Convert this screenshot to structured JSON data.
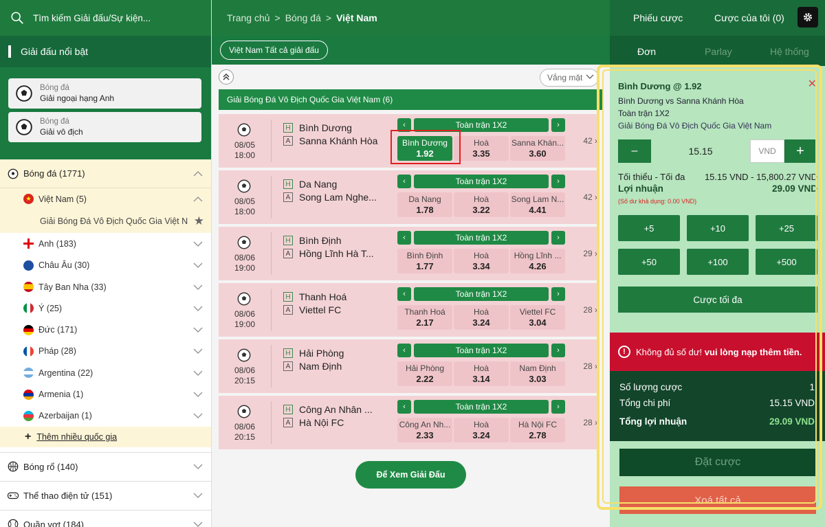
{
  "left": {
    "search_placeholder": "Tìm kiếm Giải đấu/Sự kiện...",
    "featured_title": "Giải đấu nổi bật",
    "featured": [
      {
        "sport": "Bóng đá",
        "name": "Giải ngoại hạng Anh"
      },
      {
        "sport": "Bóng đá",
        "name": "Giải vô địch"
      }
    ],
    "football": "Bóng đá (1771)",
    "countries": [
      {
        "name": "Việt Nam (5)"
      },
      {
        "name": "Anh (183)"
      },
      {
        "name": "Châu Âu (30)"
      },
      {
        "name": "Tây Ban Nha (33)"
      },
      {
        "name": "Ý (25)"
      },
      {
        "name": "Đức (171)"
      },
      {
        "name": "Pháp (28)"
      },
      {
        "name": "Argentina (22)"
      },
      {
        "name": "Armenia (1)"
      },
      {
        "name": "Azerbaijan (1)"
      }
    ],
    "league_item": "Giải Bóng Đá Vô Địch Quốc Gia Việt N",
    "more_countries": "Thêm nhiều quốc gia",
    "other_sports": [
      {
        "name": "Bóng rổ (140)"
      },
      {
        "name": "Thể thao điện tử (151)"
      },
      {
        "name": "Quần vợt (184)"
      }
    ]
  },
  "center": {
    "crumb_home": "Trang chủ",
    "crumb_sport": "Bóng đá",
    "crumb_country": "Việt Nam",
    "sep": ">",
    "filter_pill": "Việt Nam Tất cả giải đấu",
    "sort_label": "Vắng mặt",
    "league_header": "Giải Bóng Đá Vô Địch Quốc Gia Việt Nam (6)",
    "market_name": "Toàn trận 1X2",
    "matches": [
      {
        "date": "08/05",
        "time": "18:00",
        "home": "Bình Dương",
        "away": "Sanna Khánh Hòa",
        "o1": "Bình Dương",
        "v1": "1.92",
        "ox": "Hoà",
        "vx": "3.35",
        "o2": "Sanna Khán...",
        "v2": "3.60",
        "more": "42 ›"
      },
      {
        "date": "08/05",
        "time": "18:00",
        "home": "Da Nang",
        "away": "Song Lam Nghe...",
        "o1": "Da Nang",
        "v1": "1.78",
        "ox": "Hoà",
        "vx": "3.22",
        "o2": "Song Lam N...",
        "v2": "4.41",
        "more": "42 ›"
      },
      {
        "date": "08/06",
        "time": "19:00",
        "home": "Bình Định",
        "away": "Hồng Lĩnh Hà T...",
        "o1": "Bình Định",
        "v1": "1.77",
        "ox": "Hoà",
        "vx": "3.34",
        "o2": "Hồng Lĩnh ...",
        "v2": "4.26",
        "more": "29 ›"
      },
      {
        "date": "08/06",
        "time": "19:00",
        "home": "Thanh Hoá",
        "away": "Viettel FC",
        "o1": "Thanh Hoá",
        "v1": "2.17",
        "ox": "Hoà",
        "vx": "3.24",
        "o2": "Viettel FC",
        "v2": "3.04",
        "more": "28 ›"
      },
      {
        "date": "08/06",
        "time": "20:15",
        "home": "Hải Phòng",
        "away": "Nam Định",
        "o1": "Hải Phòng",
        "v1": "2.22",
        "ox": "Hoà",
        "vx": "3.14",
        "o2": "Nam Định",
        "v2": "3.03",
        "more": "28 ›"
      },
      {
        "date": "08/06",
        "time": "20:15",
        "home": "Công An Nhân ...",
        "away": "Hà Nội FC",
        "o1": "Công An Nh...",
        "v1": "2.33",
        "ox": "Hoà",
        "vx": "3.24",
        "o2": "Hà Nội FC",
        "v2": "2.78",
        "more": "28 ›"
      }
    ],
    "tag_home": "H",
    "tag_away": "A",
    "view_league_btn": "Để Xem Giải Đấu"
  },
  "right": {
    "tab_slip": "Phiếu cược",
    "tab_mybets": "Cược của tôi (0)",
    "sub_single": "Đơn",
    "sub_parlay": "Parlay",
    "sub_system": "Hệ thống",
    "slip_title": "Bình Dương @ 1.92",
    "slip_match": "Bình Dương vs Sanna Khánh Hòa",
    "slip_market": "Toàn trận 1X2",
    "slip_league": "Giải Bóng Đá Vô Địch Quốc Gia Việt Nam",
    "stake": "15.15",
    "currency": "VND",
    "minmax_label": "Tối thiểu - Tối đa",
    "minmax_value": "15.15 VND - 15,800.27 VND",
    "profit_label": "Lợi nhuận",
    "profit_value": "29.09 VND",
    "balance_note": "(Số dư khả dụng: 0.00 VND)",
    "quick": [
      "+5",
      "+10",
      "+25",
      "+50",
      "+100",
      "+500"
    ],
    "max_bet": "Cược tối đa",
    "error_prefix": "Không đủ số dư!",
    "error_bold": "vui lòng nạp thêm tiền.",
    "sum_count_label": "Số lượng cược",
    "sum_count_value": "1",
    "sum_cost_label": "Tổng chi phí",
    "sum_cost_value": "15.15 VND",
    "sum_profit_label": "Tổng lợi nhuận",
    "sum_profit_value": "29.09 VND",
    "place_bet": "Đặt cược",
    "clear_all": "Xoá tất cả"
  }
}
